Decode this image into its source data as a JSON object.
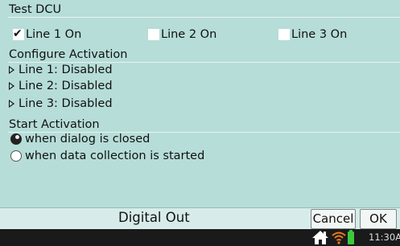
{
  "test_dcu": {
    "title": "Test DCU",
    "lines": [
      {
        "label": "Line 1 On",
        "checked": true
      },
      {
        "label": "Line 2 On",
        "checked": false
      },
      {
        "label": "Line 3 On",
        "checked": false
      }
    ]
  },
  "configure": {
    "title": "Configure Activation",
    "items": [
      "Line 1: Disabled",
      "Line 2: Disabled",
      "Line 3: Disabled"
    ]
  },
  "start": {
    "title": "Start Activation",
    "options": [
      {
        "label": "when dialog is closed",
        "selected": true
      },
      {
        "label": "when data collection is started",
        "selected": false
      }
    ]
  },
  "footer": {
    "title": "Digital Out",
    "cancel_label": "Cancel",
    "ok_label": "OK"
  },
  "status_bar": {
    "time": "11:30A",
    "icons": [
      "home-icon",
      "wifi-icon",
      "battery-icon"
    ],
    "battery_color": "#3cc83c",
    "wifi_color": "#f07a1a"
  },
  "colors": {
    "background": "#b6ddd8",
    "footer": "#d7ecea",
    "status_bar": "#1a1a1a"
  }
}
